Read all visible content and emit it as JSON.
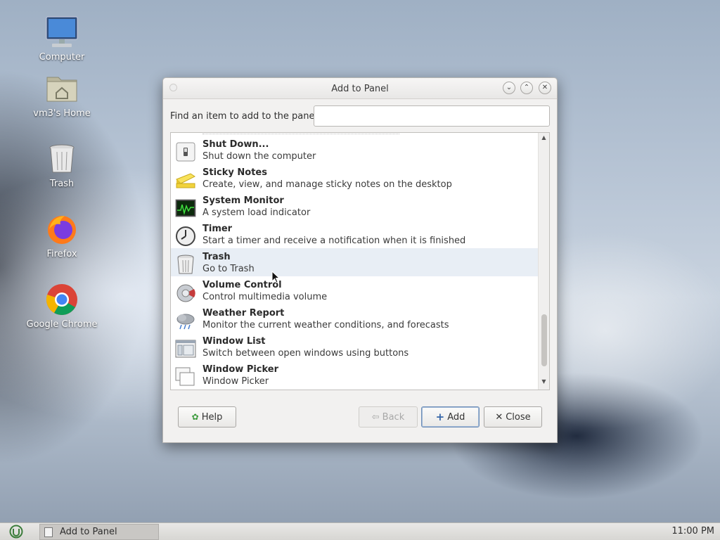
{
  "desktop": {
    "icons": [
      {
        "label": "Computer"
      },
      {
        "label": "vm3's Home"
      },
      {
        "label": "Trash"
      },
      {
        "label": "Firefox"
      },
      {
        "label": "Google Chrome"
      }
    ]
  },
  "dialog": {
    "title": "Add to Panel",
    "find_label": "Find an item to add to the panel:",
    "find_value": "",
    "items": [
      {
        "name": "Shut Down...",
        "desc": "Shut down the computer",
        "icon": "shutdown-icon"
      },
      {
        "name": "Sticky Notes",
        "desc": "Create, view, and manage sticky notes on the desktop",
        "icon": "sticky-notes-icon"
      },
      {
        "name": "System Monitor",
        "desc": "A system load indicator",
        "icon": "system-monitor-icon"
      },
      {
        "name": "Timer",
        "desc": "Start a timer and receive a notification when it is finished",
        "icon": "timer-icon"
      },
      {
        "name": "Trash",
        "desc": "Go to Trash",
        "icon": "trash-icon"
      },
      {
        "name": "Volume Control",
        "desc": "Control multimedia volume",
        "icon": "volume-icon"
      },
      {
        "name": "Weather Report",
        "desc": "Monitor the current weather conditions, and forecasts",
        "icon": "weather-icon"
      },
      {
        "name": "Window List",
        "desc": "Switch between open windows using buttons",
        "icon": "window-list-icon"
      },
      {
        "name": "Window Picker",
        "desc": "Window Picker",
        "icon": "window-picker-icon"
      }
    ],
    "buttons": {
      "help": "Help",
      "back": "Back",
      "add": "Add",
      "close": "Close"
    }
  },
  "taskbar": {
    "task_label": "Add to Panel",
    "clock": "11:00 PM"
  },
  "colors": {
    "accent": "#4a79b0",
    "hover_row": "#e8eef5"
  }
}
